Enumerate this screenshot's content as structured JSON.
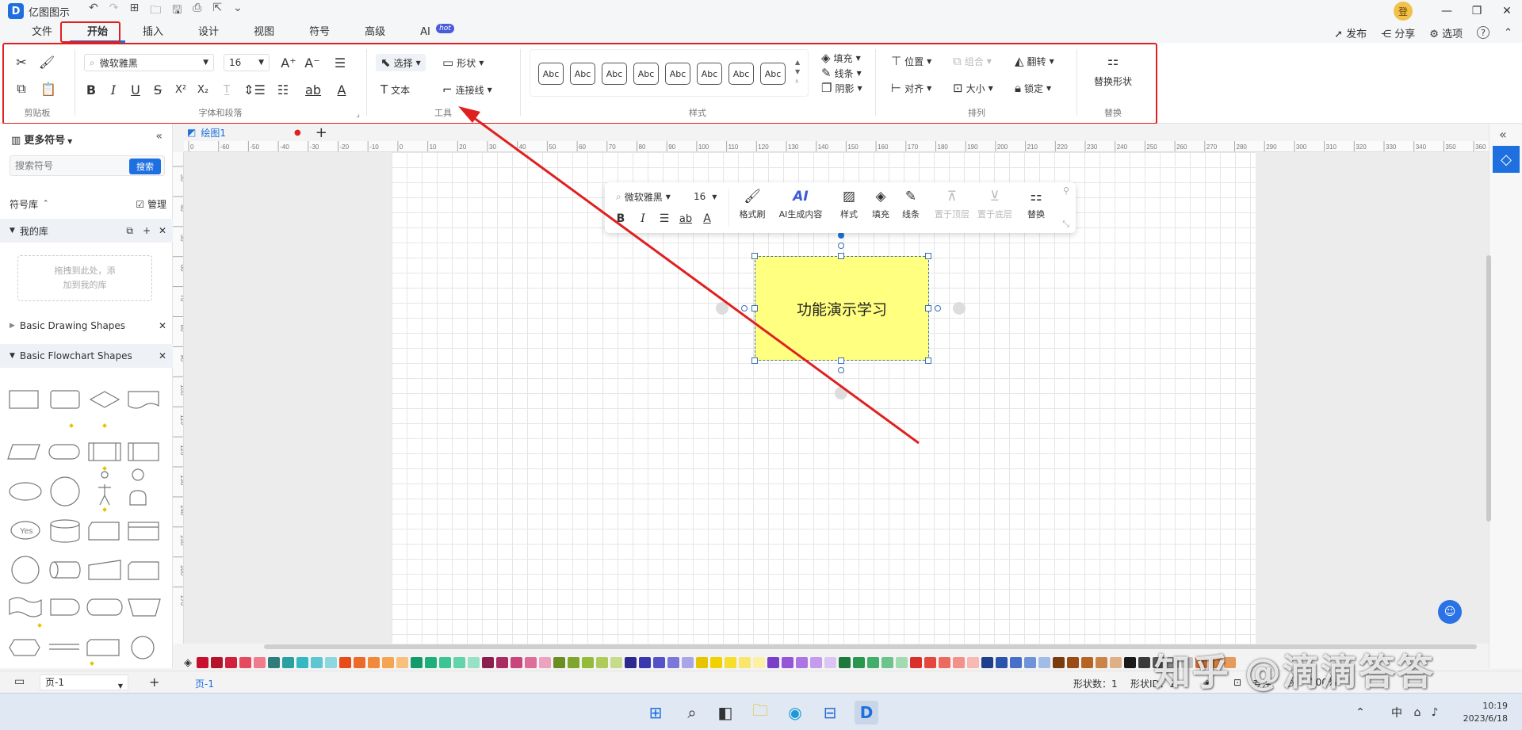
{
  "app": {
    "logo": "D",
    "name": "亿图图示",
    "account": "登"
  },
  "quick_access": {
    "undo": "↶",
    "redo": "↷",
    "new": "⊞",
    "open": "🗀",
    "save": "🖫",
    "print": "⎙",
    "export": "⇱",
    "more": "⌄"
  },
  "window_controls": {
    "minimize": "—",
    "restore": "❐",
    "close": "✕"
  },
  "menu_tabs": [
    {
      "label": "文件"
    },
    {
      "label": "开始"
    },
    {
      "label": "插入"
    },
    {
      "label": "设计"
    },
    {
      "label": "视图"
    },
    {
      "label": "符号"
    },
    {
      "label": "高级"
    },
    {
      "label": "AI",
      "badge": "hot"
    }
  ],
  "top_actions": {
    "publish": "发布",
    "share": "分享",
    "options": "选项",
    "help": "?"
  },
  "ribbon": {
    "clipboard": {
      "label": "剪贴板"
    },
    "font": {
      "family": "微软雅黑",
      "size": "16",
      "label": "字体和段落"
    },
    "tools": {
      "select": "选择",
      "shape": "形状",
      "text": "文本",
      "connector": "连接线",
      "label": "工具"
    },
    "styles": {
      "swatch_label": "Abc",
      "label": "样式",
      "fill": "填充",
      "line": "线条",
      "shadow": "阴影"
    },
    "arrange": {
      "position": "位置",
      "group": "组合",
      "flip": "翻转",
      "align": "对齐",
      "size": "大小",
      "lock": "锁定",
      "label": "排列"
    },
    "replace": {
      "button": "替换形状",
      "label": "替换"
    }
  },
  "left_panel": {
    "title": "更多符号",
    "search_placeholder": "搜索符号",
    "search_button": "搜索",
    "library_label": "符号库",
    "manage": "管理",
    "my_library": "我的库",
    "drop_hint_1": "拖拽到此处，添",
    "drop_hint_2": "加到我的库",
    "libraries": [
      {
        "name": "Basic Drawing Shapes"
      },
      {
        "name": "Basic Flowchart Shapes"
      }
    ],
    "yes_shape": "Yes"
  },
  "document": {
    "tab": "绘图1",
    "add_tab": "+"
  },
  "ruler": {
    "h": [
      "0",
      "-60",
      "-50",
      "-40",
      "-30",
      "-20",
      "-10",
      "0",
      "10",
      "20",
      "30",
      "40",
      "50",
      "60",
      "70",
      "80",
      "90",
      "100",
      "110",
      "120",
      "130",
      "140",
      "150",
      "160",
      "170",
      "180",
      "190",
      "200",
      "210",
      "220",
      "230",
      "240",
      "250",
      "260",
      "270",
      "280",
      "290",
      "300",
      "310",
      "320",
      "330",
      "340",
      "350",
      "360"
    ],
    "v": [
      "30",
      "40",
      "50",
      "60",
      "70",
      "80",
      "90",
      "100",
      "110",
      "120",
      "130",
      "140",
      "150",
      "160",
      "170"
    ]
  },
  "float_toolbar": {
    "font": "微软雅黑",
    "size": "16",
    "format_painter": "格式刷",
    "ai_generate": "AI生成内容",
    "style": "样式",
    "fill": "填充",
    "line": "线条",
    "bring_front": "置于顶层",
    "send_back": "置于底层",
    "replace": "替换"
  },
  "canvas_shape": {
    "text": "功能演示学习",
    "fill": "#ffff80"
  },
  "annotation_color": "#e02020",
  "palette": [
    "#c8102e",
    "#b5132a",
    "#d1203b",
    "#e54b5f",
    "#f07b8a",
    "#2d7d7d",
    "#2aa0a0",
    "#33b8c4",
    "#5cc7d2",
    "#8fd7df",
    "#e84a1a",
    "#ee6a2a",
    "#f08a3a",
    "#f5a452",
    "#f7c07c",
    "#139a6a",
    "#1eb07c",
    "#3cc495",
    "#62d3aa",
    "#97e2c7",
    "#8a1e4e",
    "#a92d63",
    "#c9457d",
    "#df6d9a",
    "#eda2bf",
    "#6b8e23",
    "#7ea52c",
    "#96bb3b",
    "#aecb5c",
    "#c6dc8c",
    "#2c2a8e",
    "#3a38ae",
    "#5653c8",
    "#7b78d8",
    "#a8a6e6",
    "#e8c400",
    "#f1d200",
    "#f6de2c",
    "#f9e66a",
    "#fcf0a6",
    "#7a3fc9",
    "#9555d8",
    "#ad75e2",
    "#c59ced",
    "#dcc4f4",
    "#1e7a3c",
    "#2b9650",
    "#43ae68",
    "#6cc48a",
    "#a2dbb2",
    "#d9302b",
    "#e5473d",
    "#ec6a5f",
    "#f39088",
    "#f8b8b3",
    "#1f3f8a",
    "#2b55ad",
    "#4670c7",
    "#6f93d8",
    "#a2bce8",
    "#7a3b0f",
    "#9a4c17",
    "#b56426",
    "#ca8448",
    "#dfb085",
    "#1a1a1a",
    "#3a3a3a",
    "#5a5a5a",
    "#8a8a8a",
    "#c2c2c2",
    "#cc6a2e",
    "#d98040",
    "#e69a5c"
  ],
  "status": {
    "page_select": "页-1",
    "add_page": "+",
    "page_tab": "页-1",
    "shape_count": "形状数：1",
    "shape_id": "形状ID：1",
    "focus": "专注",
    "zoom": "100%"
  },
  "taskbar": {
    "time": "10:19",
    "date": "2023/6/18",
    "ime": "中"
  },
  "watermark": "知乎 @滴滴答答"
}
